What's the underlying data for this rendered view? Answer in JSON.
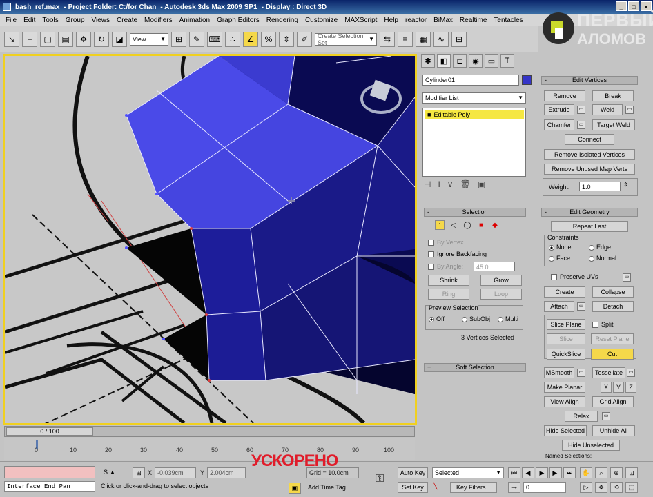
{
  "titlebar": {
    "file": "bash_ref.max",
    "project": "- Project Folder: C:/for Chan",
    "app": "- Autodesk 3ds Max 2009 SP1",
    "display": "- Display : Direct 3D"
  },
  "menu": [
    "File",
    "Edit",
    "Tools",
    "Group",
    "Views",
    "Create",
    "Modifiers",
    "Animation",
    "Graph Editors",
    "Rendering",
    "Customize",
    "MAXScript",
    "Help",
    "reactor",
    "BiMax",
    "Realtime",
    "Tentacles"
  ],
  "toolbar": {
    "view_dropdown": "View",
    "selection_set": "Create Selection Set"
  },
  "logo": {
    "line1": "ПЕРВЫЙ",
    "line2": "АЛОМОВ"
  },
  "command_panel": {
    "object_name": "Cylinder01",
    "modifier_list": "Modifier List",
    "stack_item": "Editable Poly",
    "edit_vertices": {
      "title": "Edit Vertices",
      "remove": "Remove",
      "break": "Break",
      "extrude": "Extrude",
      "weld": "Weld",
      "chamfer": "Chamfer",
      "target_weld": "Target Weld",
      "connect": "Connect",
      "remove_isolated": "Remove Isolated Vertices",
      "remove_unused": "Remove Unused Map Verts",
      "weight_label": "Weight:",
      "weight_value": "1.0"
    },
    "selection": {
      "title": "Selection",
      "by_vertex": "By Vertex",
      "ignore_backfacing": "Ignore Backfacing",
      "by_angle": "By Angle:",
      "by_angle_value": "45.0",
      "shrink": "Shrink",
      "grow": "Grow",
      "ring": "Ring",
      "loop": "Loop",
      "preview_title": "Preview Selection",
      "off": "Off",
      "subobj": "SubObj",
      "multi": "Multi",
      "status": "3 Vertices Selected"
    },
    "soft_selection": "Soft Selection",
    "edit_geometry": {
      "title": "Edit Geometry",
      "repeat_last": "Repeat Last",
      "constraints": "Constraints",
      "none": "None",
      "edge": "Edge",
      "face": "Face",
      "normal": "Normal",
      "preserve_uvs": "Preserve UVs",
      "create": "Create",
      "collapse": "Collapse",
      "attach": "Attach",
      "detach": "Detach",
      "slice_plane": "Slice Plane",
      "split": "Split",
      "slice": "Slice",
      "reset_plane": "Reset Plane",
      "quickslice": "QuickSlice",
      "cut": "Cut",
      "msmooth": "MSmooth",
      "tessellate": "Tessellate",
      "make_planar": "Make Planar",
      "x": "X",
      "y": "Y",
      "z": "Z",
      "view_align": "View Align",
      "grid_align": "Grid Align",
      "relax": "Relax",
      "hide_selected": "Hide Selected",
      "unhide_all": "Unhide All",
      "hide_unselected": "Hide Unselected",
      "named_selections": "Named Selections:"
    }
  },
  "timeline": {
    "frame": "0 / 100",
    "ticks": [
      "0",
      "10",
      "20",
      "30",
      "40",
      "50",
      "60",
      "70",
      "80",
      "90",
      "100"
    ]
  },
  "status": {
    "maxscript": "Interface End Pan",
    "prompt": "Click or click-and-drag to select objects",
    "x_label": "X",
    "x_value": "-0.039cm",
    "y_label": "Y",
    "y_value": "2.004cm",
    "grid": "Grid = 10.0cm",
    "add_time_tag": "Add Time Tag",
    "auto_key": "Auto Key",
    "set_key": "Set Key",
    "selected": "Selected",
    "key_filters": "Key Filters...",
    "frame_value": "0",
    "overlay": "УСКОРЕНО"
  }
}
